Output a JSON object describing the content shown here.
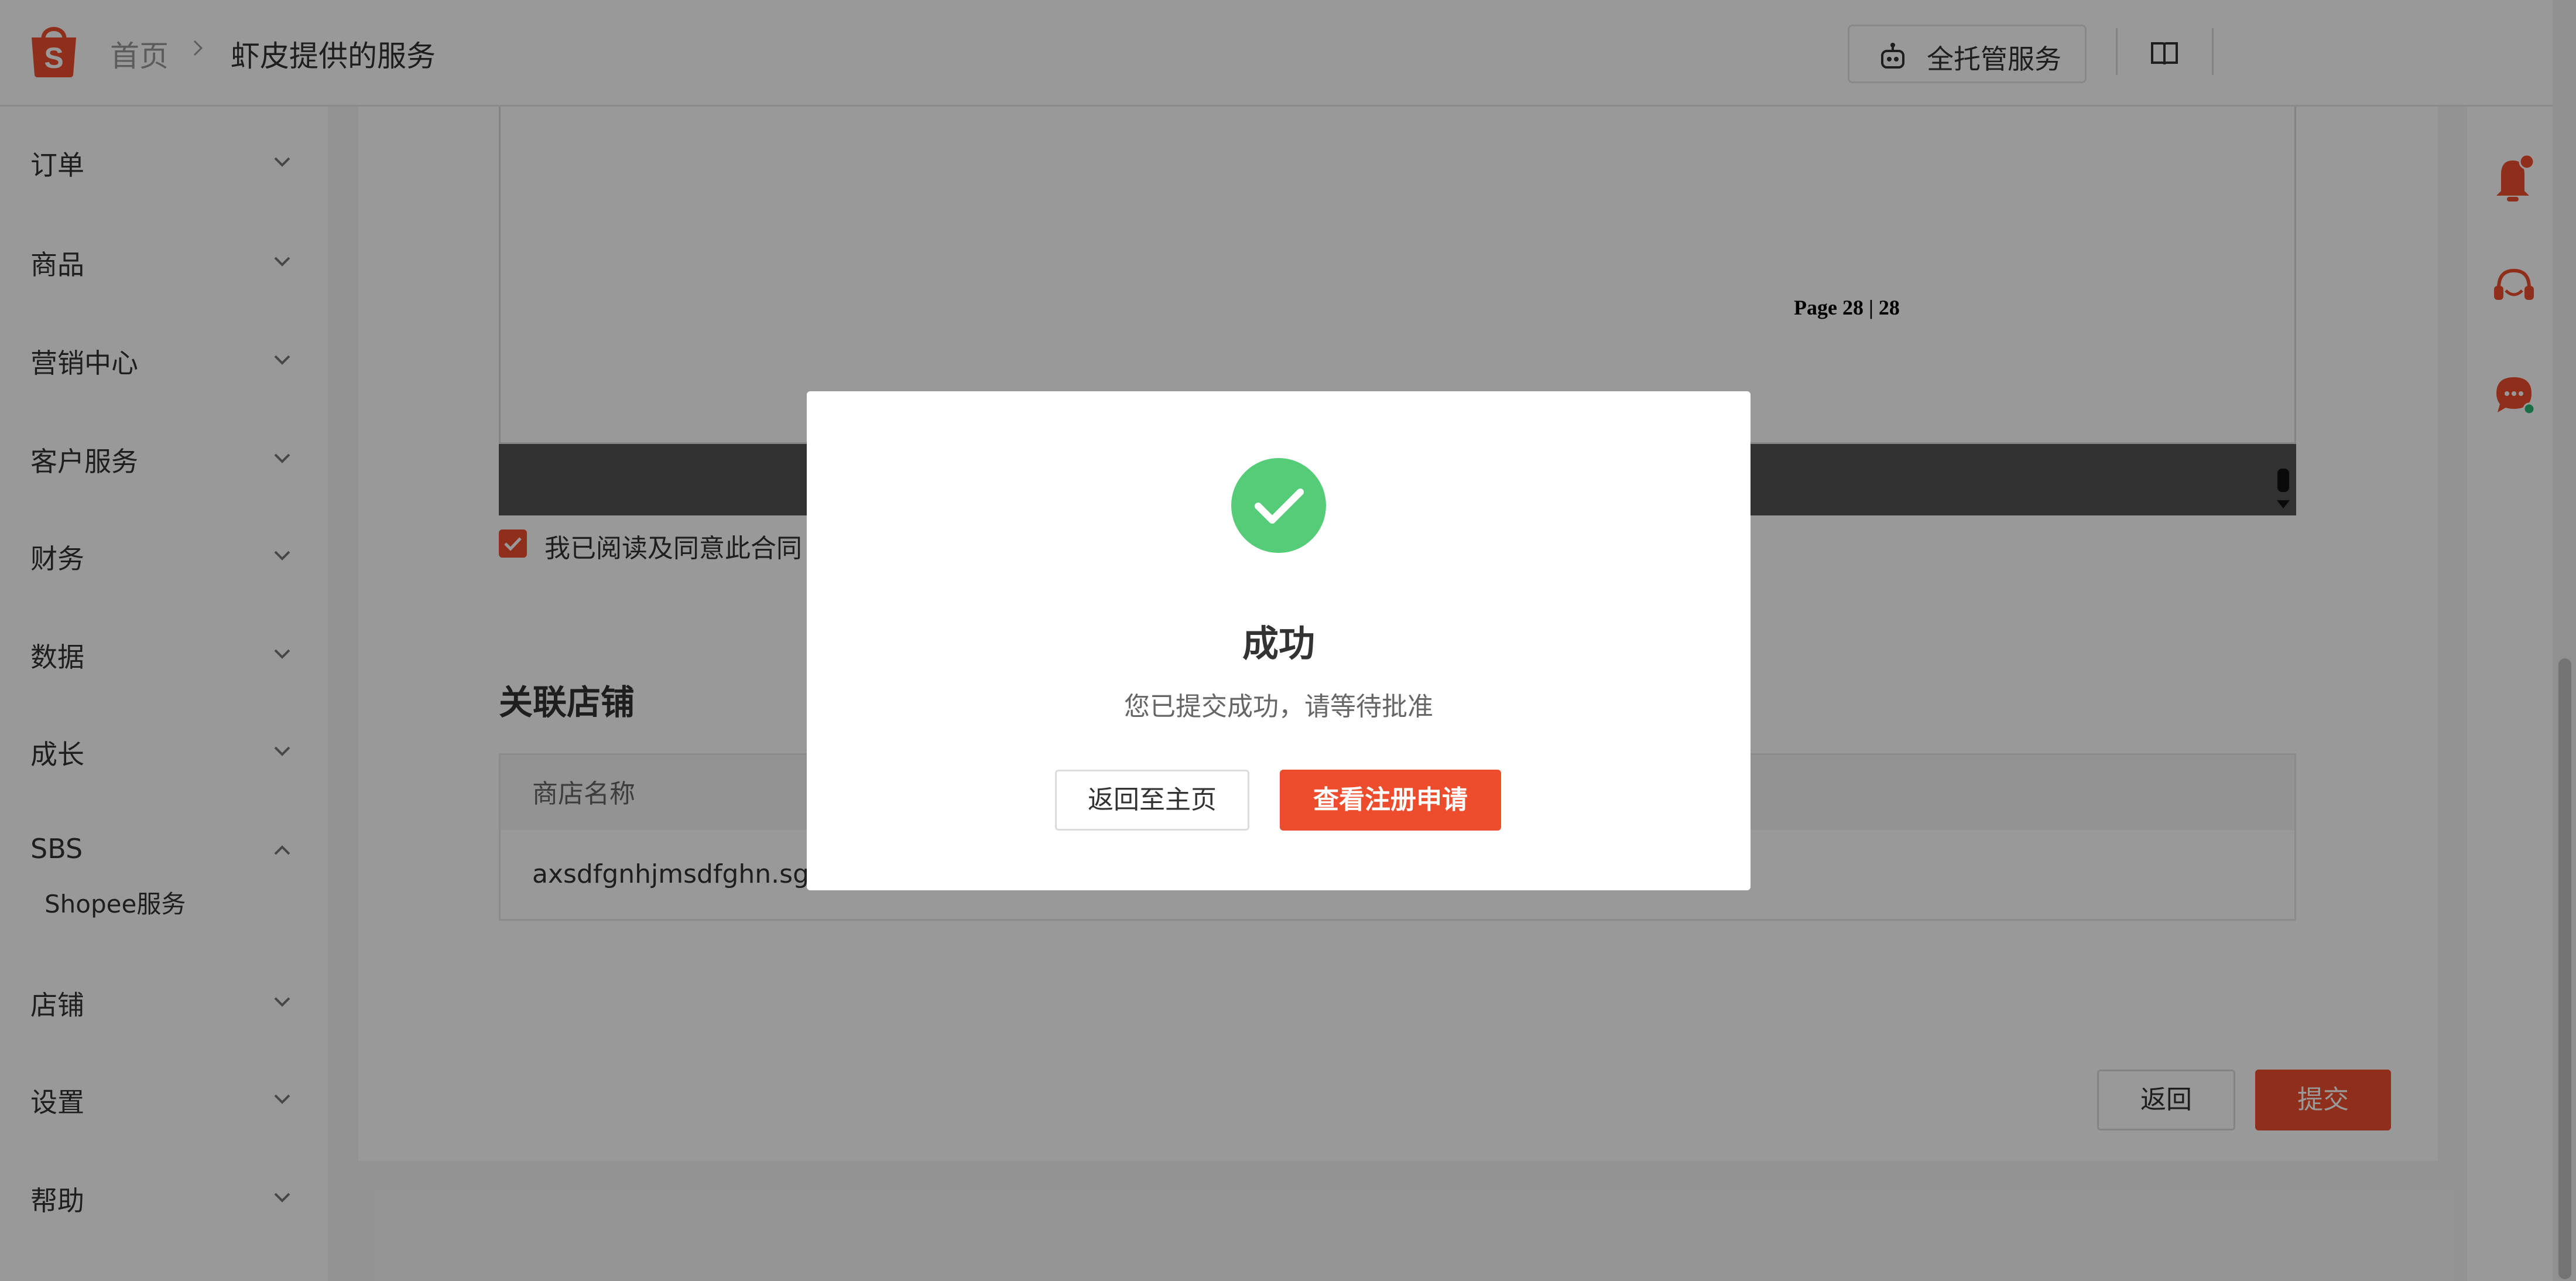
{
  "header": {
    "breadcrumb_home": "首页",
    "breadcrumb_current": "虾皮提供的服务",
    "managed_service_label": "全托管服务"
  },
  "sidebar": {
    "items": [
      {
        "label": "订单",
        "expanded": false
      },
      {
        "label": "商品",
        "expanded": false
      },
      {
        "label": "营销中心",
        "expanded": false
      },
      {
        "label": "客户服务",
        "expanded": false
      },
      {
        "label": "财务",
        "expanded": false
      },
      {
        "label": "数据",
        "expanded": false
      },
      {
        "label": "成长",
        "expanded": false
      },
      {
        "label": "SBS",
        "expanded": true
      },
      {
        "label": "店铺",
        "expanded": false
      },
      {
        "label": "设置",
        "expanded": false
      },
      {
        "label": "帮助",
        "expanded": false
      }
    ],
    "sbs_sub_item": "Shopee服务"
  },
  "contract": {
    "page_indicator": "Page 28 | 28",
    "agree_label": "我已阅读及同意此合同",
    "agree_checked": true
  },
  "linked_store": {
    "section_title": "关联店铺",
    "column_header": "商店名称",
    "rows": [
      "axsdfgnhjmsdfghn.sg"
    ]
  },
  "actions": {
    "back_label": "返回",
    "submit_label": "提交"
  },
  "modal": {
    "title": "成功",
    "description": "您已提交成功，请等待批准",
    "home_button": "返回至主页",
    "view_button": "查看注册申请"
  },
  "colors": {
    "brand": "#ee4d2d",
    "success": "#55cc77",
    "notify_dot": "#ee4d2d",
    "online_dot": "#2bb673"
  }
}
